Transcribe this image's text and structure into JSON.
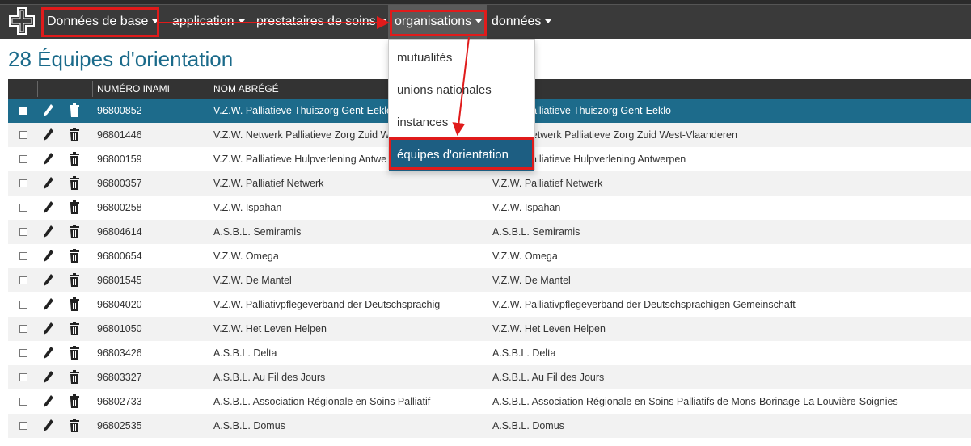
{
  "nav": {
    "items": [
      {
        "label": "Données de base"
      },
      {
        "label": "application"
      },
      {
        "label": "prestataires de soins"
      },
      {
        "label": "organisations"
      },
      {
        "label": "données"
      }
    ]
  },
  "page": {
    "title": "28 Équipes d'orientation"
  },
  "table": {
    "columns": [
      "NUMÉRO INAMI",
      "NOM ABRÉGÉ"
    ],
    "rows": [
      {
        "inami": "96800852",
        "short": "V.Z.W. Palliatieve Thuiszorg Gent-Eeklo",
        "full": "V.Z.W. Palliatieve Thuiszorg Gent-Eeklo"
      },
      {
        "inami": "96801446",
        "short": "V.Z.W. Netwerk Palliatieve Zorg Zuid W",
        "full": "V.Z.W. Netwerk Palliatieve Zorg Zuid West-Vlaanderen"
      },
      {
        "inami": "96800159",
        "short": "V.Z.W. Palliatieve Hulpverlening Antwe",
        "full": "V.Z.W. Palliatieve Hulpverlening Antwerpen"
      },
      {
        "inami": "96800357",
        "short": "V.Z.W. Palliatief Netwerk",
        "full": "V.Z.W. Palliatief Netwerk"
      },
      {
        "inami": "96800258",
        "short": "V.Z.W. Ispahan",
        "full": "V.Z.W. Ispahan"
      },
      {
        "inami": "96804614",
        "short": "A.S.B.L. Semiramis",
        "full": "A.S.B.L. Semiramis"
      },
      {
        "inami": "96800654",
        "short": "V.Z.W. Omega",
        "full": "V.Z.W. Omega"
      },
      {
        "inami": "96801545",
        "short": "V.Z.W. De Mantel",
        "full": "V.Z.W. De Mantel"
      },
      {
        "inami": "96804020",
        "short": "V.Z.W. Palliativpflegeverband der Deutschsprachig",
        "full": "V.Z.W. Palliativpflegeverband der Deutschsprachigen Gemeinschaft"
      },
      {
        "inami": "96801050",
        "short": "V.Z.W. Het Leven Helpen",
        "full": "V.Z.W. Het Leven Helpen"
      },
      {
        "inami": "96803426",
        "short": "A.S.B.L. Delta",
        "full": "A.S.B.L. Delta"
      },
      {
        "inami": "96803327",
        "short": "A.S.B.L. Au Fil des Jours",
        "full": "A.S.B.L. Au Fil des Jours"
      },
      {
        "inami": "96802733",
        "short": "A.S.B.L. Association Régionale en Soins Palliatif",
        "full": "A.S.B.L. Association Régionale en Soins Palliatifs de Mons-Borinage-La Louvière-Soignies"
      },
      {
        "inami": "96802535",
        "short": "A.S.B.L. Domus",
        "full": "A.S.B.L. Domus"
      }
    ]
  },
  "dropdown": {
    "items": [
      {
        "label": "mutualités"
      },
      {
        "label": "unions nationales"
      },
      {
        "label": "instances"
      },
      {
        "label": "équipes d'orientation"
      }
    ]
  },
  "colors": {
    "accent": "#1d6b8b",
    "highlight": "#e01b1b",
    "navbar": "#3a3a3a"
  }
}
